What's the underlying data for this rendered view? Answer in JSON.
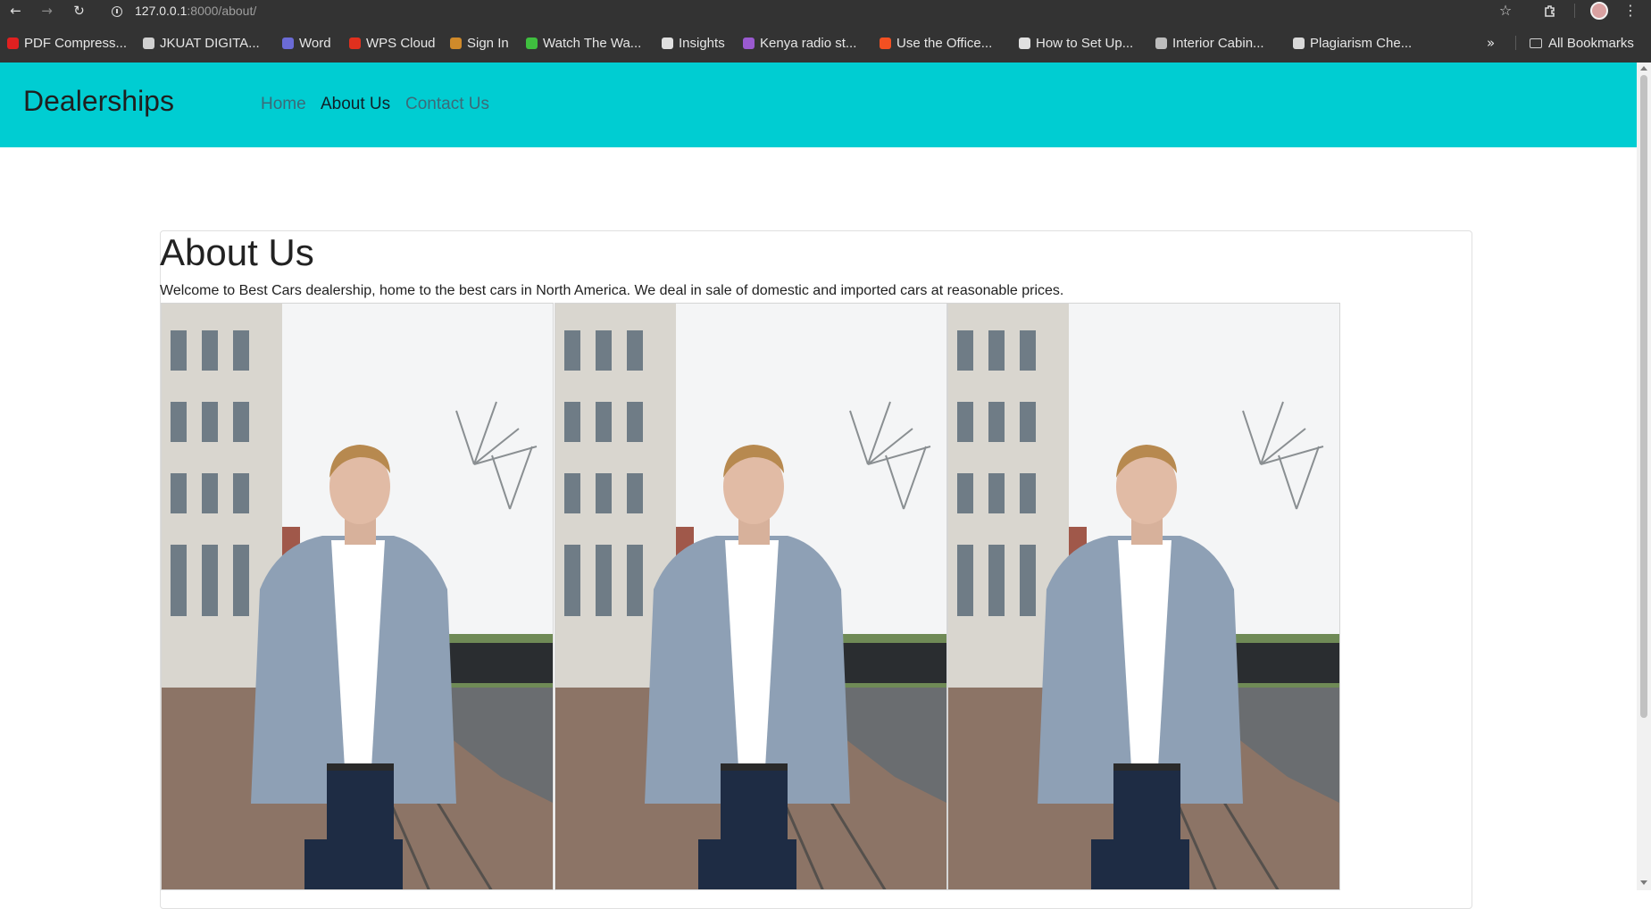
{
  "browser": {
    "url_host": "127.0.0.1",
    "url_path": ":8000/about/",
    "bookmarks": [
      {
        "label": "PDF Compress...",
        "color": "#e02020"
      },
      {
        "label": "JKUAT DIGITA...",
        "color": "#d0d0d0"
      },
      {
        "label": "Word",
        "color": "#6b6bd6"
      },
      {
        "label": "WPS Cloud",
        "color": "#e0301e"
      },
      {
        "label": "Sign In",
        "color": "#d08a2a"
      },
      {
        "label": "Watch The Wa...",
        "color": "#3fbf3f"
      },
      {
        "label": "Insights",
        "color": "#e0e0e0"
      },
      {
        "label": "Kenya radio st...",
        "color": "#9a5ad0"
      },
      {
        "label": "Use the Office...",
        "color": "#f25022"
      },
      {
        "label": "How to Set Up...",
        "color": "#e0e0e0"
      },
      {
        "label": "Interior Cabin...",
        "color": "#bdbdbd"
      },
      {
        "label": "Plagiarism Che...",
        "color": "#d9d9d9"
      }
    ],
    "all_bookmarks": "All Bookmarks"
  },
  "site": {
    "brand": "Dealerships",
    "nav": [
      {
        "label": "Home",
        "active": false
      },
      {
        "label": "About Us",
        "active": true
      },
      {
        "label": "Contact Us",
        "active": false
      }
    ]
  },
  "about": {
    "title": "About Us",
    "text": "Welcome to Best Cars dealership, home to the best cars in North America. We deal in sale of domestic and imported cars at reasonable prices.",
    "photos": 3
  }
}
